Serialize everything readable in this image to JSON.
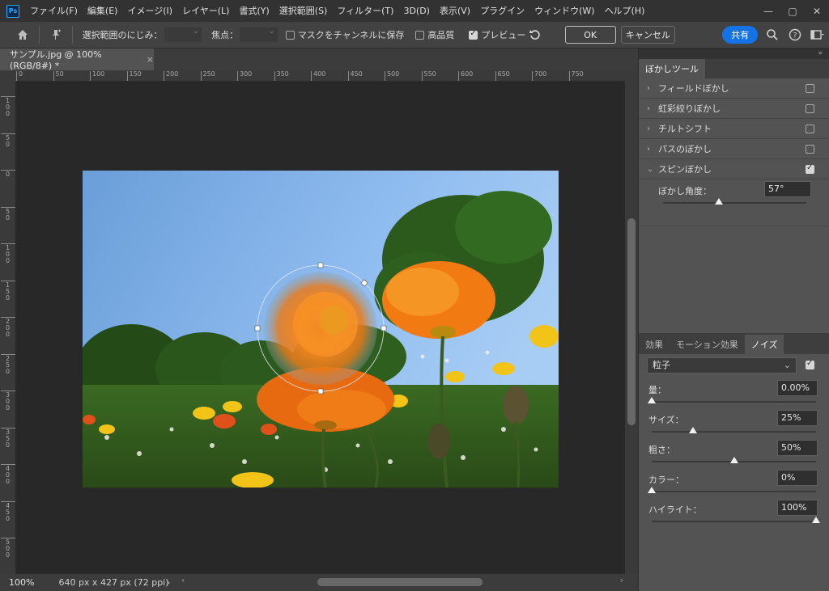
{
  "app": {
    "logo": "Ps"
  },
  "menu": [
    "ファイル(F)",
    "編集(E)",
    "イメージ(I)",
    "レイヤー(L)",
    "書式(Y)",
    "選択範囲(S)",
    "フィルター(T)",
    "3D(D)",
    "表示(V)",
    "プラグイン",
    "ウィンドウ(W)",
    "ヘルプ(H)"
  ],
  "window_controls": {
    "minimize": "—",
    "maximize": "▢",
    "close": "✕"
  },
  "options": {
    "selection_feather_label": "選択範囲のにじみ：",
    "focus_label": "焦点：",
    "save_mask_label": "マスクをチャンネルに保存",
    "save_mask_checked": false,
    "high_quality_label": "高品質",
    "high_quality_checked": false,
    "preview_label": "プレビュー",
    "preview_checked": true,
    "ok_label": "OK",
    "cancel_label": "キャンセル",
    "share_label": "共有"
  },
  "document": {
    "tab_title": "サンプル.jpg @ 100% (RGB/8#) *",
    "zoom": "100%",
    "info": "640 px x 427 px (72 ppi)"
  },
  "ruler": {
    "top": [
      "0",
      "50",
      "100",
      "150",
      "200",
      "250",
      "300",
      "350",
      "400",
      "450",
      "500",
      "550",
      "600",
      "650",
      "700",
      "750"
    ],
    "left": [
      "1\n0\n0",
      "5\n0",
      "0",
      "5\n0",
      "1\n0\n0",
      "1\n5\n0",
      "2\n0\n0",
      "2\n5\n0",
      "3\n0\n0",
      "3\n5\n0",
      "4\n0\n0",
      "4\n5\n0",
      "5\n0\n0"
    ]
  },
  "blur_panel": {
    "tab": "ぼかしツール",
    "items": [
      {
        "label": "フィールドぼかし",
        "checked": false,
        "expanded": false
      },
      {
        "label": "虹彩絞りぼかし",
        "checked": false,
        "expanded": false
      },
      {
        "label": "チルトシフト",
        "checked": false,
        "expanded": false
      },
      {
        "label": "パスのぼかし",
        "checked": false,
        "expanded": false
      },
      {
        "label": "スピンぼかし",
        "checked": true,
        "expanded": true
      }
    ],
    "spin_angle_label": "ぼかし角度：",
    "spin_angle_value": "57°",
    "spin_angle_level": 0.39
  },
  "effects_panel": {
    "tabs": [
      "効果",
      "モーション効果",
      "ノイズ"
    ],
    "active_tab": "ノイズ",
    "noise_type": "粒子",
    "noise_enabled": true,
    "params": [
      {
        "label": "量：",
        "value": "0.00%",
        "level": 0.0
      },
      {
        "label": "サイズ：",
        "value": "25%",
        "level": 0.25
      },
      {
        "label": "粗さ：",
        "value": "50%",
        "level": 0.5
      },
      {
        "label": "カラー：",
        "value": "0%",
        "level": 0.0
      },
      {
        "label": "ハイライト：",
        "value": "100%",
        "level": 1.0
      }
    ]
  },
  "colors": {
    "accent": "#1473e6",
    "sky": "#7fb0e8",
    "poppy": "#f07a10",
    "foliage": "#2f5a1e"
  }
}
